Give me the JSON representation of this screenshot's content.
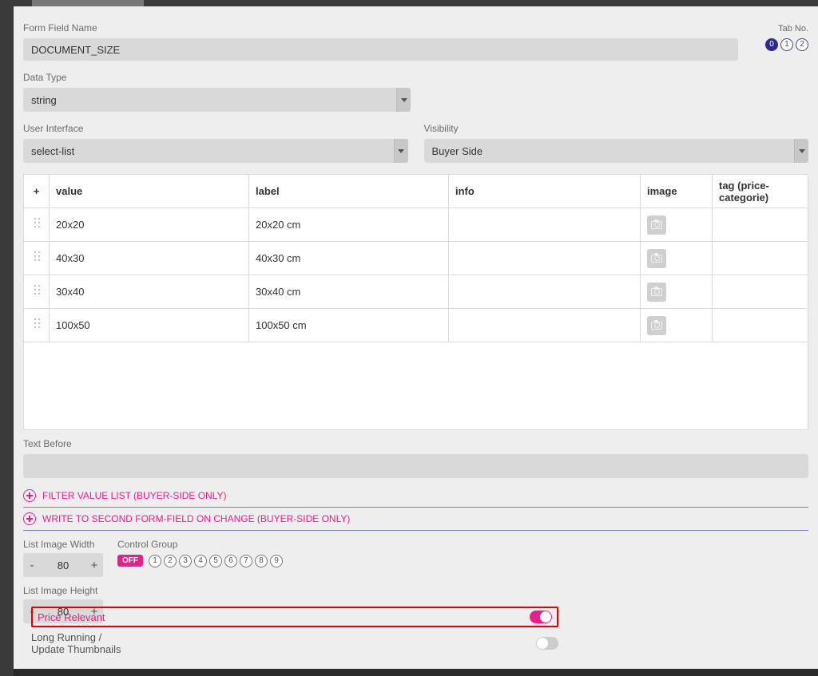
{
  "formFieldName": {
    "label": "Form Field Name",
    "value": "DOCUMENT_SIZE"
  },
  "tabNo": {
    "label": "Tab No.",
    "active": "0",
    "others": [
      "1",
      "2"
    ]
  },
  "dataType": {
    "label": "Data Type",
    "value": "string"
  },
  "userInterface": {
    "label": "User Interface",
    "value": "select-list"
  },
  "visibility": {
    "label": "Visibility",
    "value": "Buyer Side"
  },
  "table": {
    "addSymbol": "+",
    "headers": {
      "value": "value",
      "label": "label",
      "info": "info",
      "image": "image",
      "tag": "tag (price-categorie)"
    },
    "rows": [
      {
        "value": "20x20",
        "label": "20x20 cm",
        "info": "",
        "tag": ""
      },
      {
        "value": "40x30",
        "label": "40x30 cm",
        "info": "",
        "tag": ""
      },
      {
        "value": "30x40",
        "label": "30x40 cm",
        "info": "",
        "tag": ""
      },
      {
        "value": "100x50",
        "label": "100x50 cm",
        "info": "",
        "tag": ""
      }
    ]
  },
  "textBefore": {
    "label": "Text Before",
    "value": ""
  },
  "expanders": {
    "filter": "FILTER VALUE LIST (BUYER-SIDE ONLY)",
    "write": "WRITE TO SECOND FORM-FIELD ON CHANGE (BUYER-SIDE ONLY)"
  },
  "listImageWidth": {
    "label": "List Image Width",
    "value": "80"
  },
  "listImageHeight": {
    "label": "List Image Height",
    "value": "80"
  },
  "controlGroup": {
    "label": "Control Group",
    "off": "OFF",
    "numbers": [
      "1",
      "2",
      "3",
      "4",
      "5",
      "6",
      "7",
      "8",
      "9"
    ]
  },
  "toggles": {
    "priceRelevant": {
      "label": "Price Relevant",
      "on": true
    },
    "longRunning": {
      "label": "Long Running /\nUpdate Thumbnails",
      "on": false
    }
  },
  "spinner": {
    "minus": "-",
    "plus": "+"
  }
}
